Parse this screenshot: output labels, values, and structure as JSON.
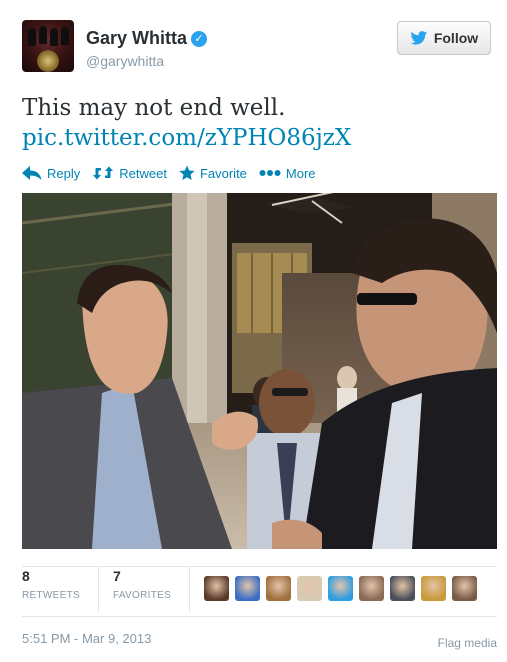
{
  "user": {
    "display_name": "Gary Whitta",
    "handle": "@garywhitta",
    "verified_glyph": "✓"
  },
  "follow_button": {
    "label": "Follow",
    "icon": "twitter-bird-icon"
  },
  "tweet": {
    "text": "This may not end well.",
    "link": "pic.twitter.com/zYPHO86jzX"
  },
  "actions": [
    {
      "label": "Reply",
      "icon": "reply-icon"
    },
    {
      "label": "Retweet",
      "icon": "retweet-icon"
    },
    {
      "label": "Favorite",
      "icon": "star-icon"
    },
    {
      "label": "More",
      "icon": "more-dots-icon"
    }
  ],
  "stats": {
    "retweets": {
      "count": "8",
      "label": "RETWEETS"
    },
    "favorites": {
      "count": "7",
      "label": "FAVORITES"
    }
  },
  "faces": [
    {
      "color": "#5a3a2a"
    },
    {
      "color": "#3b6fc4"
    },
    {
      "color": "#a0703f"
    },
    {
      "color": "#d7cbb5"
    },
    {
      "color": "#2f9de0"
    },
    {
      "color": "#8a6a55"
    },
    {
      "color": "#4a4f58"
    },
    {
      "color": "#c99a3a"
    },
    {
      "color": "#7a5a48"
    }
  ],
  "timestamp": "5:51 PM - Mar 9, 2013",
  "flag_label": "Flag media",
  "colors": {
    "link": "#0084b4",
    "muted": "#8899a6",
    "verified": "#2aa3ef"
  }
}
